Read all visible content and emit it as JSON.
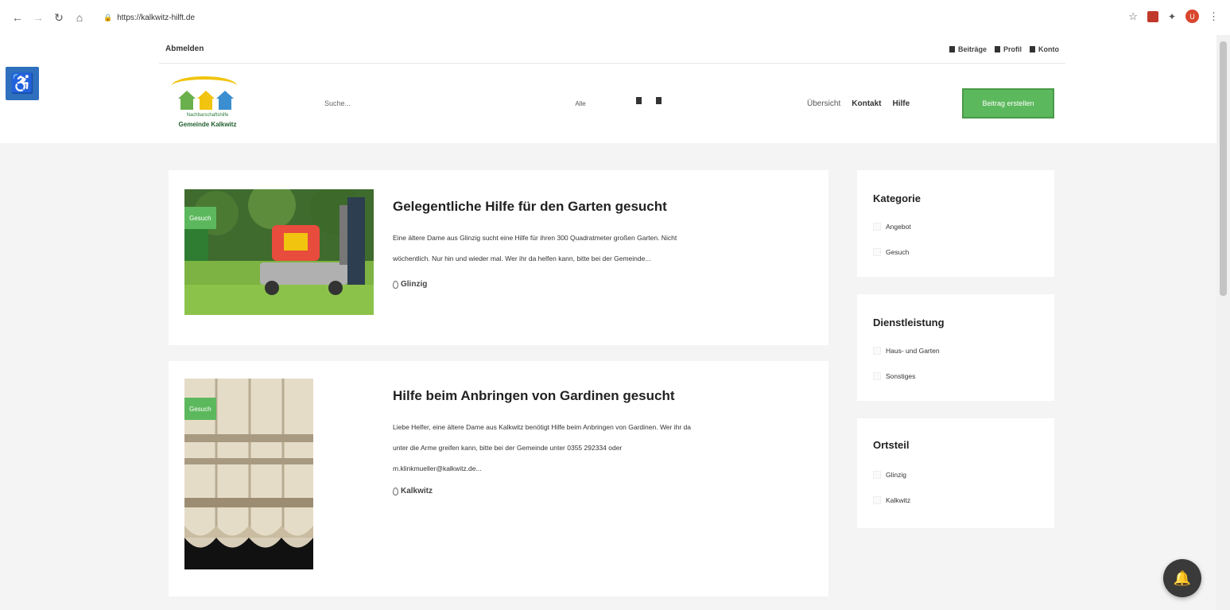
{
  "browser": {
    "url": "https://kalkwitz-hilft.de"
  },
  "header": {
    "logout": "Abmelden",
    "account_links": [
      "Beiträge",
      "Profil",
      "Konto"
    ],
    "logo_subtitle": "Nachbarschaftshilfe",
    "logo_title": "Gemeinde Kalkwitz",
    "search_placeholder": "Suche...",
    "filter_all": "Alle",
    "nav": [
      "Übersicht",
      "Kontakt",
      "Hilfe"
    ],
    "cta": "Beitrag erstellen"
  },
  "posts": [
    {
      "badge": "Gesuch",
      "title": "Gelegentliche Hilfe für den Garten gesucht",
      "text_line1": "Eine ältere Dame aus Glinzig sucht eine Hilfe für ihren 300 Quadratmeter großen Garten. Nicht",
      "text_line2": "wöchentlich. Nur hin und wieder mal. Wer ihr da helfen kann, bitte bei der Gemeinde...",
      "location": "Glinzig"
    },
    {
      "badge": "Gesuch",
      "title": "Hilfe beim Anbringen von Gardinen gesucht",
      "text_line1": "Liebe Helfer, eine ältere Dame aus Kalkwitz benötigt Hilfe beim Anbringen von Gardinen. Wer ihr da",
      "text_line2": "unter die Arme greifen kann, bitte bei der Gemeinde unter 0355 292334 oder",
      "text_line3": "m.klinkmueller@kalkwitz.de...",
      "location": "Kalkwitz"
    }
  ],
  "sidebar": {
    "kategorie": {
      "title": "Kategorie",
      "options": [
        "Angebot",
        "Gesuch"
      ]
    },
    "dienstleistung": {
      "title": "Dienstleistung",
      "options": [
        "Haus- und Garten",
        "Sonstiges"
      ]
    },
    "ortsteil": {
      "title": "Ortsteil",
      "options": [
        "Glinzig",
        "Kalkwitz"
      ]
    }
  },
  "colors": {
    "accent_green": "#5cb85c",
    "a11y_blue": "#2e6fbe"
  }
}
